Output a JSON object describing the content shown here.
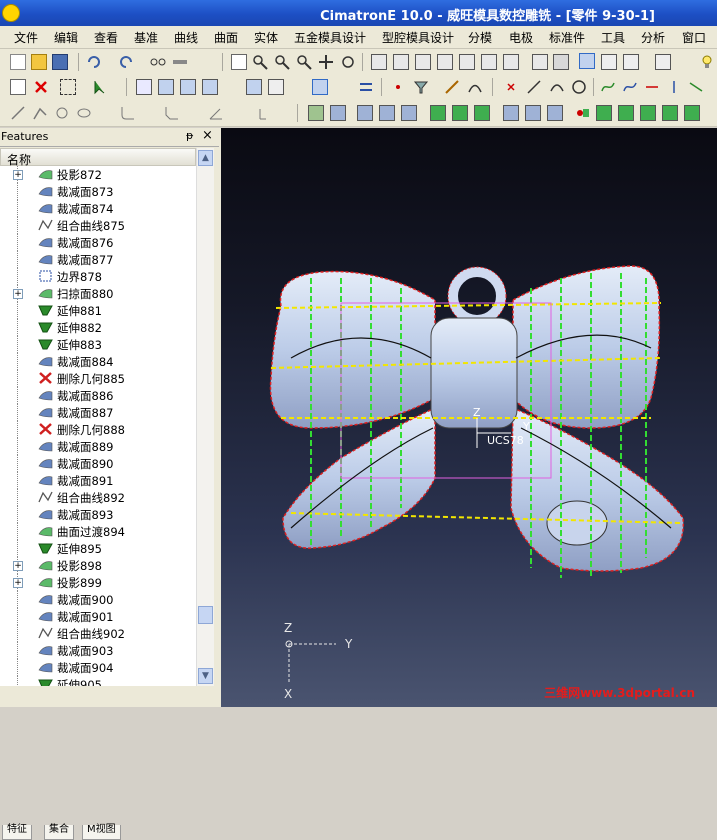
{
  "window": {
    "title": "CimatronE 10.0 - 威旺模具数控雕铣 - [零件 9-30-1]"
  },
  "menu": [
    "文件",
    "编辑",
    "查看",
    "基准",
    "曲线",
    "曲面",
    "实体",
    "五金模具设计",
    "型腔模具设计",
    "分模",
    "电极",
    "标准件",
    "工具",
    "分析",
    "窗口"
  ],
  "features_panel": {
    "title": "Features",
    "column_header": "名称",
    "items": [
      {
        "label": "投影872",
        "icon": "projection-icon",
        "expand": true
      },
      {
        "label": "裁减面873",
        "icon": "trim-surface-icon",
        "expand": false
      },
      {
        "label": "裁减面874",
        "icon": "trim-surface-icon",
        "expand": false
      },
      {
        "label": "组合曲线875",
        "icon": "composite-curve-icon",
        "expand": false
      },
      {
        "label": "裁减面876",
        "icon": "trim-surface-icon",
        "expand": false
      },
      {
        "label": "裁减面877",
        "icon": "trim-surface-icon",
        "expand": false
      },
      {
        "label": "边界878",
        "icon": "boundary-icon",
        "expand": false
      },
      {
        "label": "扫掠面880",
        "icon": "sweep-surface-icon",
        "expand": true
      },
      {
        "label": "延伸881",
        "icon": "extend-icon",
        "expand": false
      },
      {
        "label": "延伸882",
        "icon": "extend-icon",
        "expand": false
      },
      {
        "label": "延伸883",
        "icon": "extend-icon",
        "expand": false
      },
      {
        "label": "裁减面884",
        "icon": "trim-surface-icon",
        "expand": false
      },
      {
        "label": "删除几何885",
        "icon": "delete-geometry-icon",
        "expand": false
      },
      {
        "label": "裁减面886",
        "icon": "trim-surface-icon",
        "expand": false
      },
      {
        "label": "裁减面887",
        "icon": "trim-surface-icon",
        "expand": false
      },
      {
        "label": "删除几何888",
        "icon": "delete-geometry-icon",
        "expand": false
      },
      {
        "label": "裁减面889",
        "icon": "trim-surface-icon",
        "expand": false
      },
      {
        "label": "裁减面890",
        "icon": "trim-surface-icon",
        "expand": false
      },
      {
        "label": "裁减面891",
        "icon": "trim-surface-icon",
        "expand": false
      },
      {
        "label": "组合曲线892",
        "icon": "composite-curve-icon",
        "expand": false
      },
      {
        "label": "裁减面893",
        "icon": "trim-surface-icon",
        "expand": false
      },
      {
        "label": "曲面过渡894",
        "icon": "blend-surface-icon",
        "expand": false
      },
      {
        "label": "延伸895",
        "icon": "extend-icon",
        "expand": false
      },
      {
        "label": "投影898",
        "icon": "projection-icon",
        "expand": true
      },
      {
        "label": "投影899",
        "icon": "projection-icon",
        "expand": true
      },
      {
        "label": "裁减面900",
        "icon": "trim-surface-icon",
        "expand": false
      },
      {
        "label": "裁减面901",
        "icon": "trim-surface-icon",
        "expand": false
      },
      {
        "label": "组合曲线902",
        "icon": "composite-curve-icon",
        "expand": false
      },
      {
        "label": "裁减面903",
        "icon": "trim-surface-icon",
        "expand": false
      },
      {
        "label": "裁减面904",
        "icon": "trim-surface-icon",
        "expand": false
      },
      {
        "label": "延伸905",
        "icon": "extend-icon",
        "expand": false
      }
    ],
    "tabs": [
      "特征",
      "集合",
      "M视图"
    ]
  },
  "viewport": {
    "ucs_label": "UCS78",
    "triad": {
      "z": "Z",
      "y": "Y",
      "x": "X"
    },
    "small_axis_labels": {
      "y": "Y",
      "z": "Z"
    }
  },
  "watermark": "三维网www.3dportal.cn",
  "colors": {
    "title_bar": "#1d4fc4",
    "surface": "#bfcde8",
    "edge_red": "#e02020",
    "grid_green": "#33dd33",
    "point_yellow": "#f2e600",
    "pink_box": "#e060e0"
  }
}
